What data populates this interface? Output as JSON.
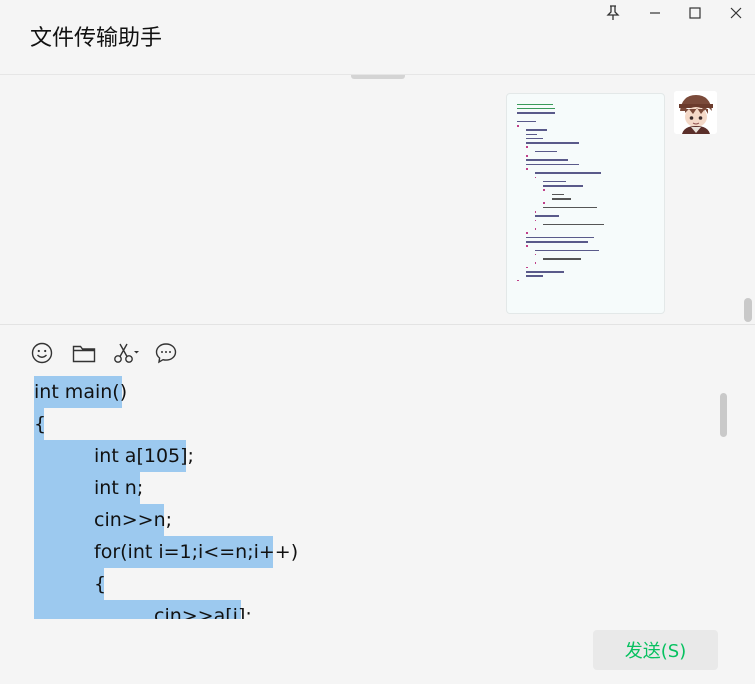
{
  "window": {
    "title": "文件传输助手"
  },
  "chat": {
    "image_alt": "C++ code screenshot",
    "image_code_lines": [
      "#include <iostream>",
      "#include <algorithm>",
      "using namespace std;",
      "",
      "int main()",
      "{",
      "    int a[105];",
      "    int n;",
      "    cin >> n;",
      "    for (int i = 1; i <= n; i++)",
      "    {",
      "        cin >> a[i];",
      "    }",
      "    int maxn[100005] = {};",
      "    for (int i = 1; i <= n; i++)",
      "    {",
      "        for (int j = 1; j * j <= a[i]; j++)",
      "        {",
      "            int cnt = 0;",
      "            while (a[i] % j == 0)",
      "            {",
      "                cnt++;",
      "                a[i] /= j;",
      "            }",
      "            maxn[j] = max(maxn[j], cnt);",
      "        }",
      "        if (a[i] > 1)",
      "        {",
      "            maxn[a[i]] = max(maxn[a[i]], 1);",
      "        }",
      "    }",
      "    long long res = 1, mod = 1000000007;",
      "    for (int i = 1; i <= 100000; i++)",
      "    {",
      "        for (int j = 1; j <= maxn[i]; j++)",
      "        {",
      "            res = res * i % mod;",
      "        }",
      "    }",
      "    cout << res << endl;",
      "    return 0;",
      "}"
    ]
  },
  "toolbar": {
    "emoji_icon": "emoji-icon",
    "folder_icon": "folder-icon",
    "scissors_icon": "scissors-icon",
    "chat_history_icon": "chat-bubble-icon"
  },
  "editor": {
    "lines": [
      "int main()",
      "{",
      "int a[105];",
      "int n;",
      "cin>>n;",
      "for(int i=1;i<=n;i++)",
      "{",
      "cin>>a[i];"
    ],
    "selection_color": "#9cc9ef"
  },
  "send_button": {
    "label": "发送(S)",
    "color": "#07c160"
  }
}
